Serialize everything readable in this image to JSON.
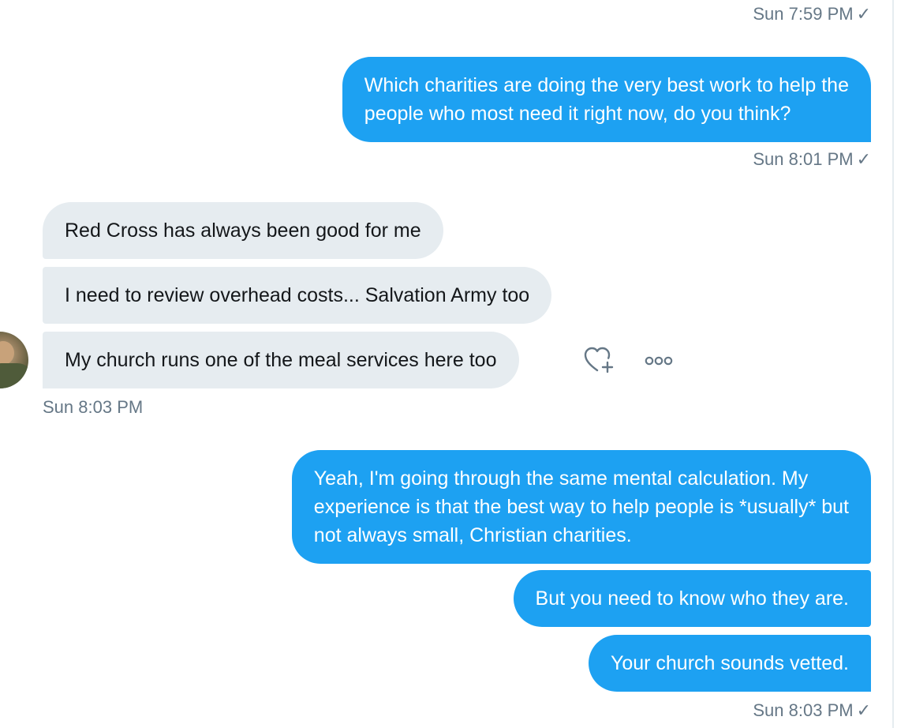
{
  "conversation": {
    "messages": [
      {
        "id": "m1",
        "direction": "outgoing",
        "lines": [
          "Which charities are doing the very best work to help the",
          "people who most need it right now, do you think?"
        ]
      },
      {
        "id": "m2",
        "direction": "incoming",
        "text": "Red Cross has always been good for me"
      },
      {
        "id": "m3",
        "direction": "incoming",
        "text": "I need to review overhead costs... Salvation Army too"
      },
      {
        "id": "m4",
        "direction": "incoming",
        "text": "My church runs one of the meal services here too"
      },
      {
        "id": "m5",
        "direction": "outgoing",
        "lines": [
          "Yeah, I'm going through the same mental calculation. My",
          "experience is that the best way to help people is *usually* but",
          "not always small, Christian charities."
        ]
      },
      {
        "id": "m6",
        "direction": "outgoing",
        "text": "But you need to know who they are."
      },
      {
        "id": "m7",
        "direction": "outgoing",
        "text": "Your church sounds vetted."
      }
    ],
    "timestamps": {
      "top": "Sun 7:59 PM",
      "after_m1": "Sun 8:01 PM",
      "after_incoming": "Sun 8:03 PM",
      "bottom": "Sun 8:03 PM"
    },
    "read_check": "✓"
  },
  "icons": {
    "like": "heart-plus-icon",
    "more": "more-options-icon"
  },
  "colors": {
    "outgoing_bubble": "#1da1f2",
    "incoming_bubble": "#e6ecf0",
    "timestamp": "#657786",
    "text_dark": "#14171a"
  }
}
